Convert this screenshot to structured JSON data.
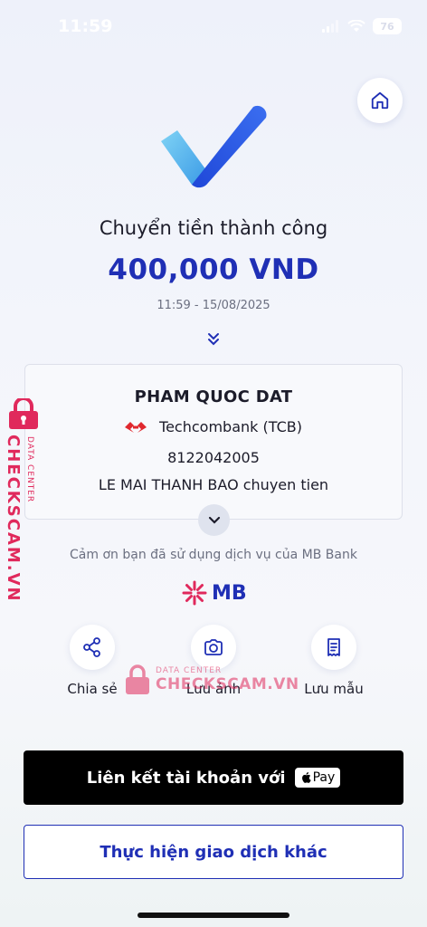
{
  "status_bar": {
    "time": "11:59",
    "battery": "76"
  },
  "header": {
    "title": "Chuyển tiền thành công",
    "amount": "400,000 VND",
    "datetime": "11:59 - 15/08/2025"
  },
  "receiver": {
    "name": "PHAM QUOC DAT",
    "bank": "Techcombank (TCB)",
    "account_number": "8122042005",
    "memo": "LE MAI THANH BAO chuyen tien"
  },
  "thanks_text": "Cảm ơn bạn đã sử dụng dịch vụ của MB Bank",
  "brand": {
    "logo_text": "MB",
    "color": "#1f2fb5",
    "accent": "#e0295c"
  },
  "actions": [
    {
      "label": "Chia sẻ",
      "icon": "share-icon"
    },
    {
      "label": "Lưu ảnh",
      "icon": "camera-icon"
    },
    {
      "label": "Lưu mẫu",
      "icon": "receipt-icon"
    }
  ],
  "buttons": {
    "apple_pay_label": "Liên kết tài khoản với",
    "apple_pay_badge": "Pay",
    "other_transaction_label": "Thực hiện giao dịch khác"
  },
  "watermark": {
    "brand": "CHECKSCAM.VN",
    "sub": "DATA CENTER"
  }
}
